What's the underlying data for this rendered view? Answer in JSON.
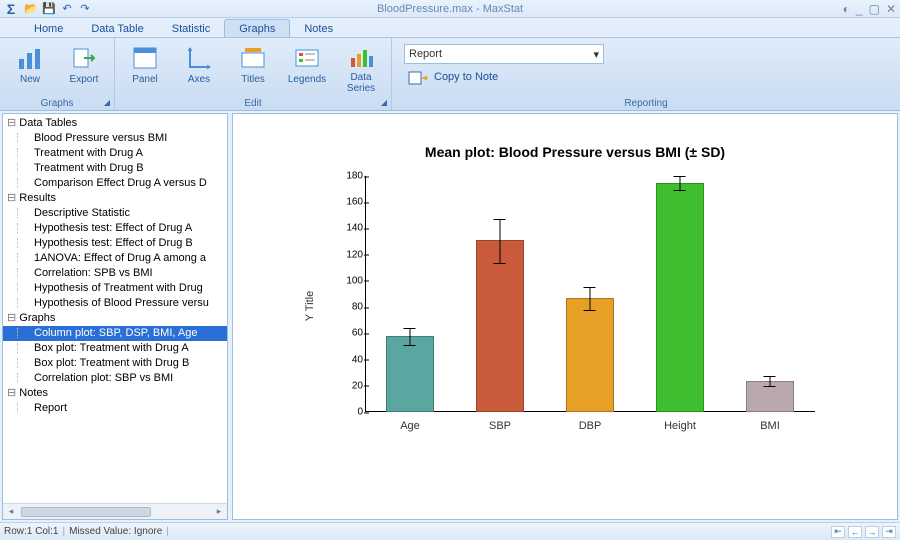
{
  "window": {
    "title": "BloodPressure.max - MaxStat"
  },
  "menu_tabs": [
    "Home",
    "Data Table",
    "Statistic",
    "Graphs",
    "Notes"
  ],
  "menu_active": 3,
  "ribbon": {
    "groups": [
      {
        "name": "Graphs",
        "buttons": [
          {
            "label": "New",
            "icon": "bar-chart-icon"
          },
          {
            "label": "Export",
            "icon": "export-icon"
          }
        ],
        "launcher": true
      },
      {
        "name": "Edit",
        "buttons": [
          {
            "label": "Panel",
            "icon": "panel-icon"
          },
          {
            "label": "Axes",
            "icon": "axes-icon"
          },
          {
            "label": "Titles",
            "icon": "titles-icon"
          },
          {
            "label": "Legends",
            "icon": "legend-icon"
          },
          {
            "label": "Data Series",
            "icon": "data-series-icon"
          }
        ],
        "launcher": true
      }
    ],
    "report": {
      "label": "Report",
      "copy_label": "Copy to Note"
    },
    "reporting_group": "Reporting"
  },
  "tree": {
    "groups": [
      {
        "label": "Data Tables",
        "items": [
          "Blood Pressure versus BMI",
          "Treatment with Drug A",
          "Treatment with Drug B",
          "Comparison Effect Drug A versus D"
        ]
      },
      {
        "label": "Results",
        "items": [
          "Descriptive Statistic",
          "Hypothesis test: Effect of Drug A",
          "Hypothesis test: Effect of Drug B",
          "1ANOVA: Effect of Drug A among a",
          "Correlation: SPB vs BMI",
          "Hypothesis of Treatment with Drug",
          "Hypothesis of Blood Pressure versu"
        ]
      },
      {
        "label": "Graphs",
        "items": [
          "Column plot: SBP, DSP, BMI, Age",
          "Box plot: Treatment with Drug A",
          "Box plot: Treatment with Drug B",
          "Correlation plot: SBP vs BMI"
        ],
        "selected": 0
      },
      {
        "label": "Notes",
        "items": [
          "Report"
        ]
      }
    ]
  },
  "chart_data": {
    "type": "bar",
    "title": "Mean plot: Blood Pressure versus BMI (± SD)",
    "ylabel": "Y Title",
    "xlabel": "",
    "ylim": [
      0,
      180
    ],
    "yticks": [
      0,
      20,
      40,
      60,
      80,
      100,
      120,
      140,
      160,
      180
    ],
    "categories": [
      "Age",
      "SBP",
      "DBP",
      "Height",
      "BMI"
    ],
    "values": [
      58,
      131,
      87,
      175,
      24
    ],
    "errors": [
      7,
      17,
      9,
      6,
      4
    ],
    "colors": [
      "#5aa7a1",
      "#c95b3c",
      "#e7a026",
      "#3fbf2f",
      "#b9a9ad"
    ]
  },
  "status": {
    "row": "Row:1 Col:1",
    "missed": "Missed Value: Ignore"
  }
}
